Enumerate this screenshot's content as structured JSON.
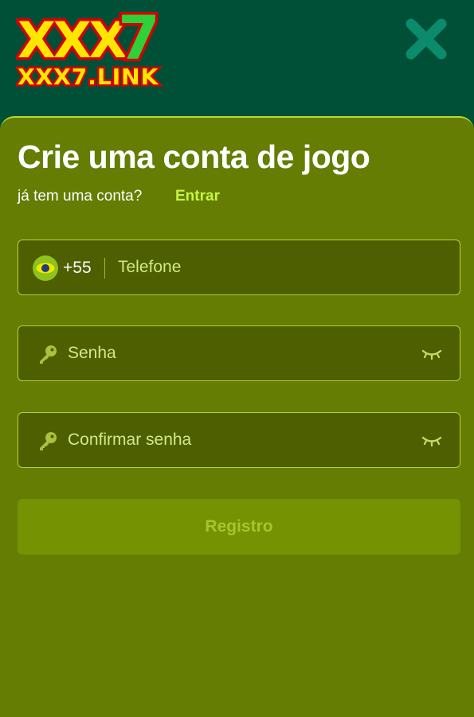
{
  "brand": {
    "logo_main": "XXX7",
    "logo_sub": "XXX7.LINK"
  },
  "header": {
    "close_icon": "close-icon"
  },
  "form": {
    "title": "Crie uma conta de jogo",
    "subtitle": "já tem uma conta?",
    "login_link": "Entrar",
    "phone": {
      "country_code": "+55",
      "flag_icon": "brazil-flag-icon",
      "placeholder": "Telefone",
      "value": ""
    },
    "password": {
      "placeholder": "Senha",
      "value": "",
      "icon": "key-icon",
      "toggle_icon": "eye-closed-icon"
    },
    "confirm_password": {
      "placeholder": "Confirmar senha",
      "value": "",
      "icon": "key-icon",
      "toggle_icon": "eye-closed-icon"
    },
    "submit_label": "Registro"
  },
  "colors": {
    "header_bg": "#005038",
    "sheet_bg": "#647d02",
    "field_bg": "#4d5f01",
    "field_border": "#b3d23a",
    "accent": "#c8f542",
    "button_bg": "#749202",
    "button_text": "#a8c42c"
  }
}
